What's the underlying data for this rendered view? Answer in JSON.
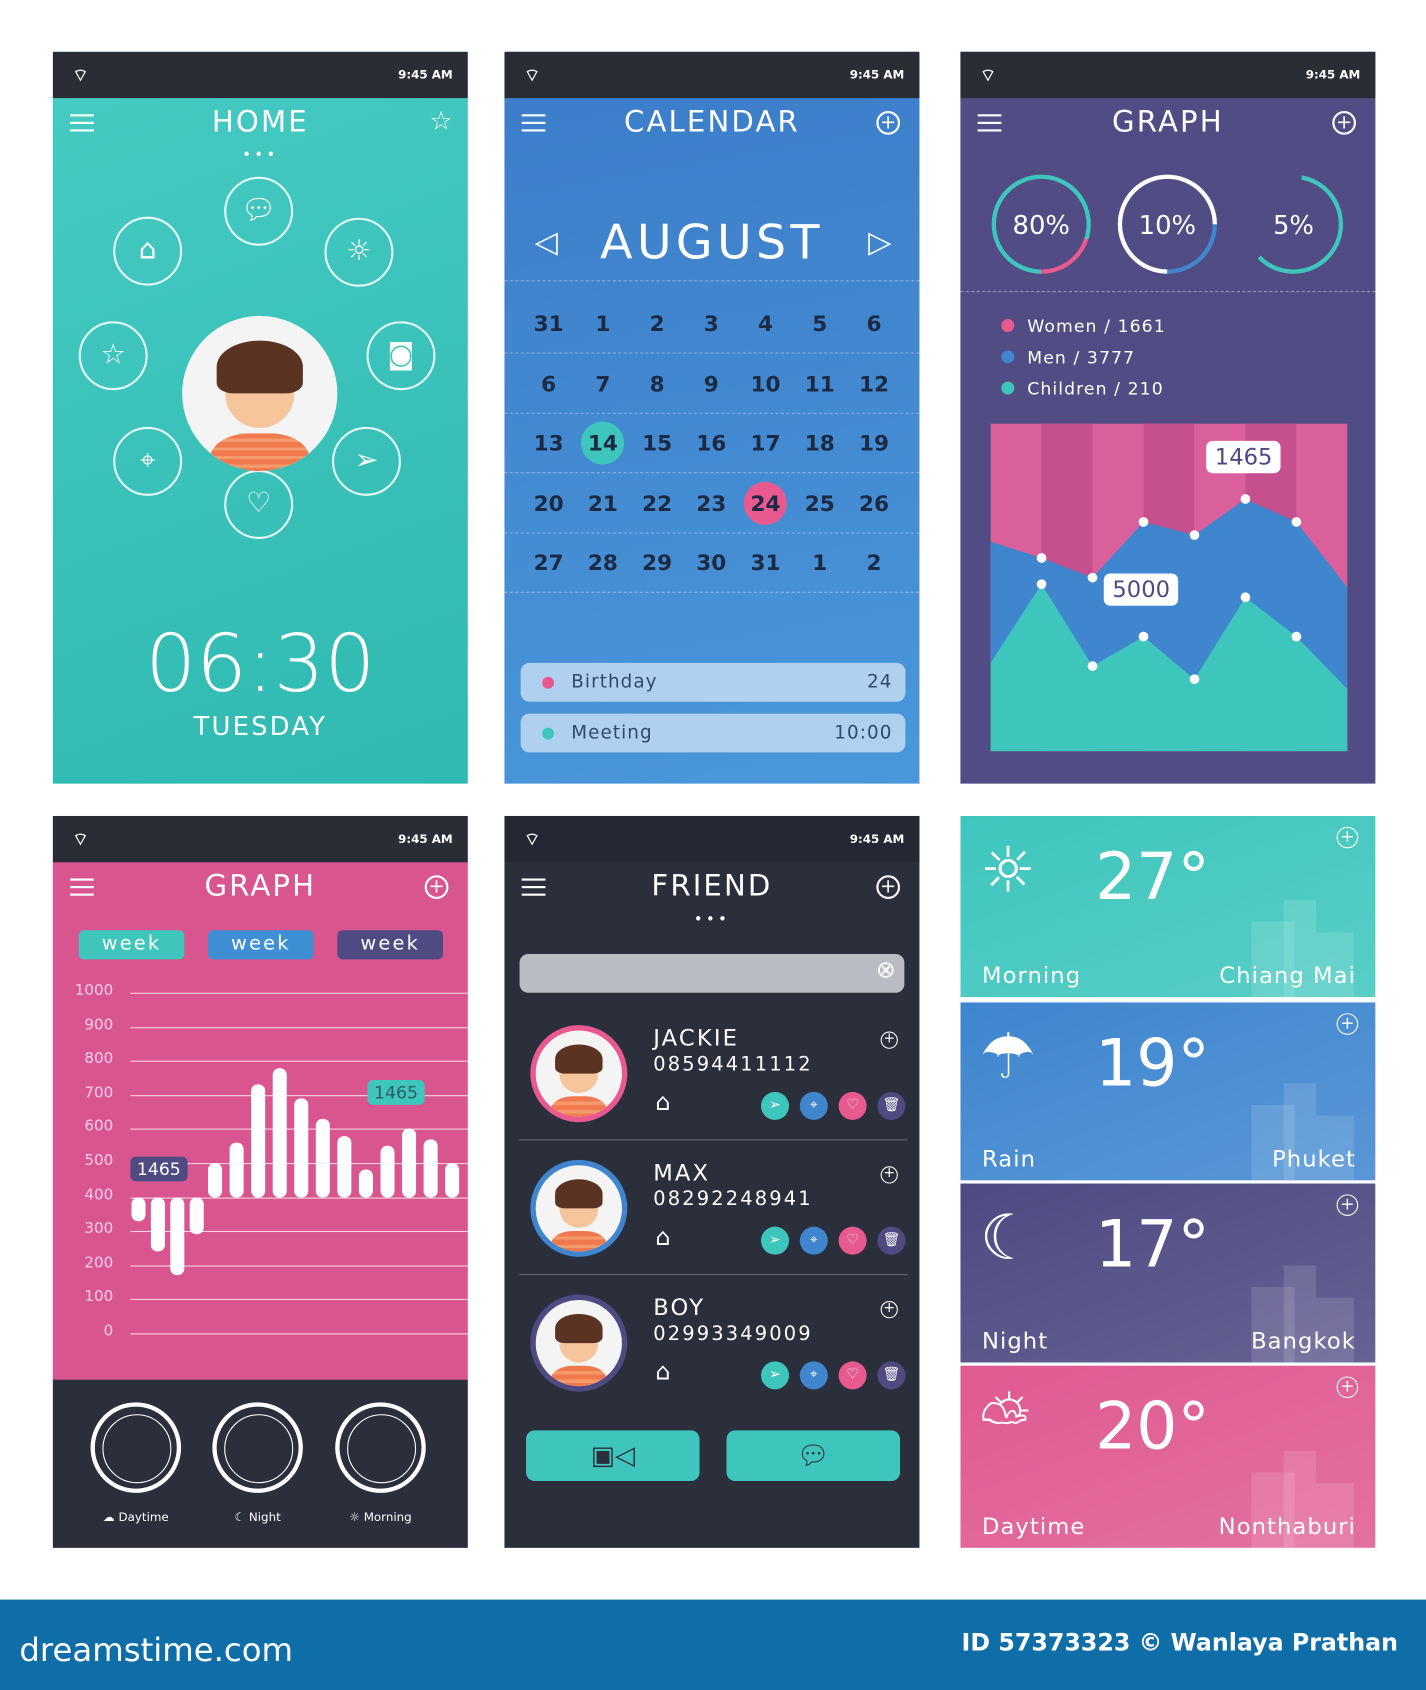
{
  "status": {
    "time": "9:45 AM",
    "wifi_icon": "wifi-icon",
    "battery_icon": "battery-icon"
  },
  "home": {
    "title": "HOME",
    "dots": "•••",
    "time": "06:30",
    "day": "TUESDAY",
    "bg": "#3ec6bd",
    "icons": [
      "home-icon",
      "chat-icon",
      "sun-icon",
      "star-icon",
      "camera-icon",
      "pin-icon",
      "heart-icon",
      "send-icon"
    ]
  },
  "calendar": {
    "title": "CALENDAR",
    "month": "AUGUST",
    "prev": "◁",
    "next": "▷",
    "bg": "#3f86cf",
    "weeks": [
      [
        "31",
        "1",
        "2",
        "3",
        "4",
        "5",
        "6"
      ],
      [
        "6",
        "7",
        "8",
        "9",
        "10",
        "11",
        "12"
      ],
      [
        "13",
        "14",
        "15",
        "16",
        "17",
        "18",
        "19"
      ],
      [
        "20",
        "21",
        "22",
        "23",
        "24",
        "25",
        "26"
      ],
      [
        "27",
        "28",
        "29",
        "30",
        "31",
        "1",
        "2"
      ]
    ],
    "selected_teal": "14",
    "selected_pink": "24",
    "events": [
      {
        "name": "Birthday",
        "value": "24",
        "color": "#e85a8f"
      },
      {
        "name": "Meeting",
        "value": "10:00",
        "color": "#3ec6bd"
      }
    ]
  },
  "graph1": {
    "title": "GRAPH",
    "bg": "#4f4a82",
    "donuts": [
      {
        "label": "80%",
        "value": 80
      },
      {
        "label": "10%",
        "value": 10
      },
      {
        "label": "5%",
        "value": 5
      }
    ],
    "legend": [
      {
        "label": "Women  / 1661",
        "color": "#e85a8f"
      },
      {
        "label": "Men / 3777",
        "color": "#3f86cf"
      },
      {
        "label": "Children / 210",
        "color": "#3ec6bd"
      }
    ],
    "callouts": [
      "1465",
      "5000"
    ]
  },
  "graph2": {
    "title": "GRAPH",
    "weeks": [
      "week",
      "week",
      "week"
    ],
    "callouts": [
      "1465",
      "1465"
    ],
    "clocks": [
      {
        "label": "Daytime",
        "icon": "cloud-sun-icon"
      },
      {
        "label": "Night",
        "icon": "moon-icon"
      },
      {
        "label": "Morning",
        "icon": "sun-icon"
      }
    ]
  },
  "friend": {
    "title": "FRIEND",
    "dots": "•••",
    "search_placeholder": "",
    "friends": [
      {
        "name": "JACKIE",
        "phone": "08594411112",
        "ring": "#e85a8f"
      },
      {
        "name": "MAX",
        "phone": "08292248941",
        "ring": "#3f86cf"
      },
      {
        "name": "BOY",
        "phone": "02993349009",
        "ring": "#4f4a82"
      }
    ],
    "video_icon": "video-camera-icon",
    "chat_icon": "chat-icon"
  },
  "weather": [
    {
      "temp": "27°",
      "label": "Morning",
      "city": "Chiang Mai",
      "icon": "sun-icon",
      "bg": "#3ec6bd"
    },
    {
      "temp": "19°",
      "label": "Rain",
      "city": "Phuket",
      "icon": "rain-cloud-icon",
      "bg": "#3f86cf"
    },
    {
      "temp": "17°",
      "label": "Night",
      "city": "Bangkok",
      "icon": "moon-icon",
      "bg": "#4f4a82"
    },
    {
      "temp": "20°",
      "label": "Daytime",
      "city": "Nonthaburi",
      "icon": "cloud-sun-icon",
      "bg": "#df5a92"
    }
  ],
  "footer": {
    "logo": "dreamstime.com",
    "credit": "ID 57373323 © Wanlaya Prathan",
    "bg": "#0f6ea8"
  },
  "chart_data": [
    {
      "type": "area",
      "title": "",
      "series": [
        {
          "values": [
            64,
            59,
            53,
            70,
            66,
            77,
            70,
            50
          ],
          "color": "#3f86cf"
        },
        {
          "values": [
            27,
            51,
            26,
            35,
            22,
            47,
            35,
            19
          ],
          "color": "#3ec6bd"
        }
      ],
      "annotations": [
        "1465",
        "5000"
      ]
    },
    {
      "type": "bar",
      "title": "",
      "ylim": [
        0,
        1000
      ],
      "yticks": [
        1000,
        900,
        800,
        700,
        600,
        500,
        400,
        300,
        200,
        100,
        0
      ],
      "baseline": 400,
      "values": [
        330,
        240,
        170,
        290,
        500,
        560,
        730,
        780,
        690,
        630,
        580,
        480,
        550,
        600,
        570,
        500
      ],
      "annotations": [
        "1465",
        "1465"
      ],
      "grid": true
    }
  ]
}
